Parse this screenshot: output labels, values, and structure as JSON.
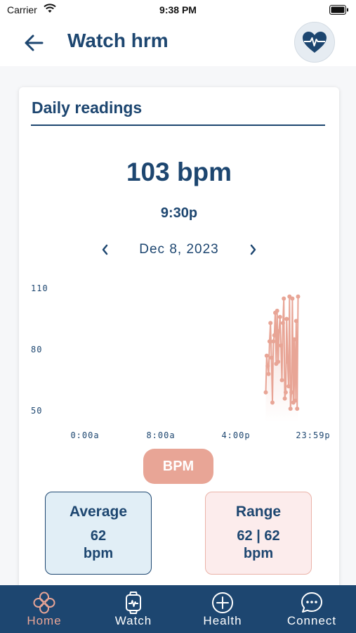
{
  "status_bar": {
    "carrier": "Carrier",
    "time": "9:38 PM"
  },
  "header": {
    "title": "Watch hrm"
  },
  "card": {
    "title": "Daily readings",
    "current_bpm": "103 bpm",
    "current_time": "9:30p",
    "date": "Dec 8, 2023"
  },
  "chart_data": {
    "type": "line",
    "x_range": [
      "0:00a",
      "23:59p"
    ],
    "y_ticks": [
      "50",
      "80",
      "110"
    ],
    "x_ticks": [
      "0:00a",
      "8:00a",
      "4:00p",
      "23:59p"
    ],
    "ylim": [
      50,
      110
    ],
    "series": [
      {
        "color": "#e8a596",
        "points": [
          {
            "x": "19:00",
            "y": 59
          },
          {
            "x": "19:06",
            "y": 77
          },
          {
            "x": "19:12",
            "y": 72
          },
          {
            "x": "19:18",
            "y": 68
          },
          {
            "x": "19:24",
            "y": 84
          },
          {
            "x": "19:30",
            "y": 93
          },
          {
            "x": "19:36",
            "y": 76
          },
          {
            "x": "19:42",
            "y": 54
          },
          {
            "x": "19:48",
            "y": 84
          },
          {
            "x": "19:54",
            "y": 87
          },
          {
            "x": "20:00",
            "y": 98
          },
          {
            "x": "20:06",
            "y": 73
          },
          {
            "x": "20:12",
            "y": 99
          },
          {
            "x": "20:18",
            "y": 74
          },
          {
            "x": "20:24",
            "y": 89
          },
          {
            "x": "20:30",
            "y": 96
          },
          {
            "x": "20:36",
            "y": 82
          },
          {
            "x": "20:42",
            "y": 65
          },
          {
            "x": "20:48",
            "y": 93
          },
          {
            "x": "20:54",
            "y": 105
          },
          {
            "x": "21:00",
            "y": 56
          },
          {
            "x": "21:06",
            "y": 59
          },
          {
            "x": "21:12",
            "y": 95
          },
          {
            "x": "21:18",
            "y": 74
          },
          {
            "x": "21:24",
            "y": 62
          },
          {
            "x": "21:30",
            "y": 106
          },
          {
            "x": "21:36",
            "y": 51
          },
          {
            "x": "21:42",
            "y": 59
          },
          {
            "x": "21:48",
            "y": 105
          },
          {
            "x": "21:54",
            "y": 54
          },
          {
            "x": "22:00",
            "y": 85
          },
          {
            "x": "22:06",
            "y": 55
          },
          {
            "x": "22:12",
            "y": 94
          },
          {
            "x": "22:18",
            "y": 51
          },
          {
            "x": "22:24",
            "y": 106
          }
        ]
      }
    ]
  },
  "bpm_button": {
    "label": "BPM"
  },
  "stats": {
    "average": {
      "title": "Average",
      "value": "62",
      "unit": "bpm"
    },
    "range": {
      "title": "Range",
      "value": "62 | 62",
      "unit": "bpm"
    }
  },
  "tabs": [
    {
      "label": "Home",
      "icon": "home-flower-icon",
      "active": true
    },
    {
      "label": "Watch",
      "icon": "watch-icon",
      "active": false
    },
    {
      "label": "Health",
      "icon": "plus-circle-icon",
      "active": false
    },
    {
      "label": "Connect",
      "icon": "chat-bubble-icon",
      "active": false
    }
  ],
  "colors": {
    "primary": "#1d4670",
    "accent": "#e8a596"
  }
}
